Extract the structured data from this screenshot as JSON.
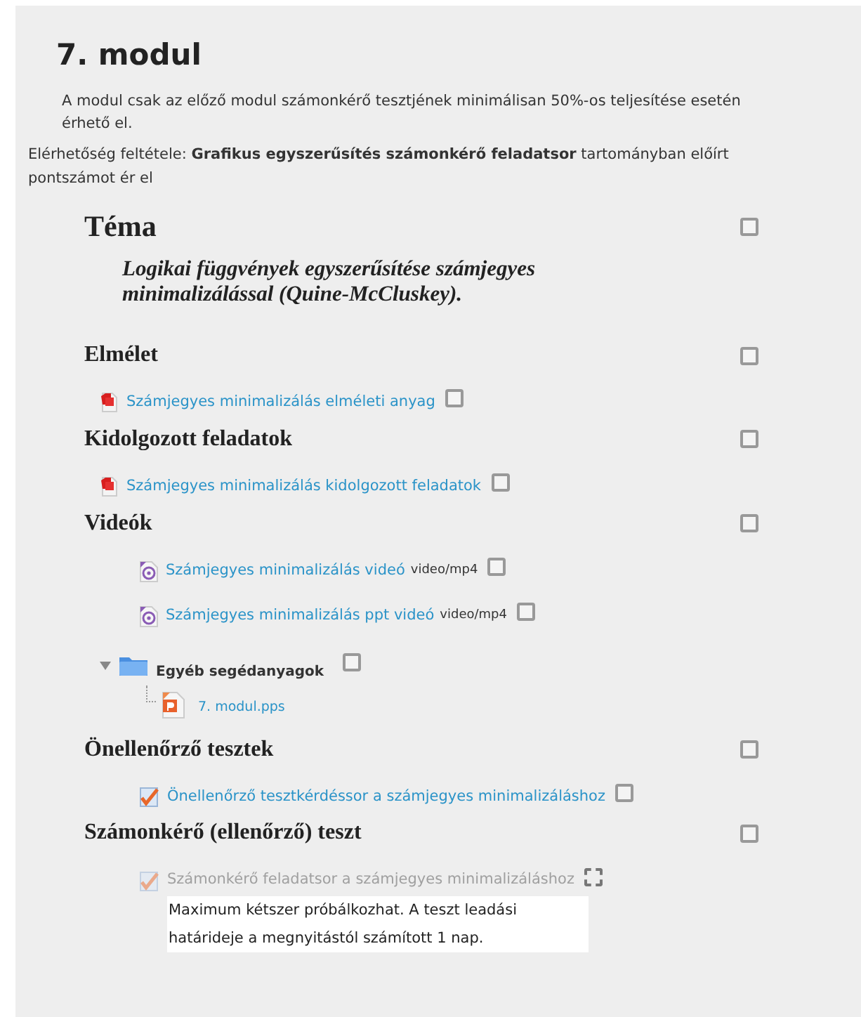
{
  "module": {
    "title": "7. modul",
    "restriction": "A modul csak az előző modul számonkérő tesztjének minimálisan 50%-os teljesítése esetén érhető el.",
    "condition": "Elérhetőség feltétele: **Grafikus egyszerűsítés számonkérő feladatsor** tartományban előírt pontszámot ér el"
  },
  "sections": [
    {
      "heading": "Téma",
      "kind": "topic",
      "checked": false,
      "items": [
        {
          "kind": "description",
          "text": "Logikai függvények egyszerűsítése számjegyes minimalizálással (Quine-McCluskey)."
        }
      ]
    },
    {
      "heading": "Elmélet",
      "kind": "heading",
      "checked": false,
      "items": [
        {
          "kind": "pdf",
          "text": "Számjegyes minimalizálás elméleti anyag",
          "completion": {
            "kind": "manual",
            "checked": false
          }
        }
      ]
    },
    {
      "heading": "Kidolgozott feladatok",
      "kind": "heading",
      "checked": false,
      "items": [
        {
          "kind": "pdf",
          "text": "Számjegyes minimalizálás kidolgozott feladatok",
          "completion": {
            "kind": "manual",
            "checked": false
          }
        }
      ]
    },
    {
      "heading": "Videók",
      "kind": "heading",
      "checked": false,
      "items": [
        {
          "kind": "video",
          "text": "Számjegyes minimalizálás videó",
          "type": "video/mp4",
          "completion": {
            "kind": "manual",
            "checked": false
          }
        },
        {
          "kind": "video",
          "text": "Számjegyes minimalizálás ppt videó",
          "type": "video/mp4",
          "completion": {
            "kind": "manual",
            "checked": false
          }
        },
        {
          "kind": "folder",
          "text": "Egyéb segédanyagok",
          "expanded": true,
          "completion": {
            "kind": "manual",
            "checked": false
          },
          "children": [
            {
              "kind": "pps",
              "text": "7. modul.pps"
            }
          ]
        }
      ]
    },
    {
      "heading": "Önellenőrző tesztek",
      "kind": "heading",
      "checked": false,
      "items": [
        {
          "kind": "quiz",
          "text": "Önellenőrző tesztkérdéssor a számjegyes minimalizáláshoz",
          "disabled": false,
          "completion": {
            "kind": "manual",
            "checked": false
          }
        }
      ]
    },
    {
      "heading": "Számonkérő (ellenőrző) teszt",
      "kind": "heading",
      "checked": false,
      "items": [
        {
          "kind": "quiz",
          "text": "Számonkérő feladatsor a számjegyes minimalizáláshoz",
          "disabled": true,
          "completion": {
            "kind": "auto",
            "checked": false
          },
          "note": "Maximum kétszer próbálkozhat. A teszt leadási határideje a megnyitástól számított 1 nap."
        }
      ]
    }
  ]
}
